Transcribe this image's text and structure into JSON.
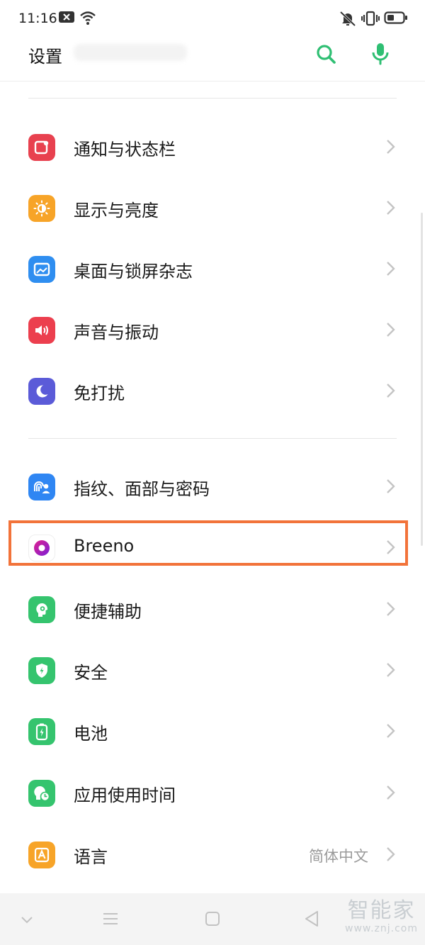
{
  "status_bar": {
    "time": "11:16"
  },
  "header": {
    "title": "设置"
  },
  "sections": [
    {
      "items": [
        {
          "label": "通知与状态栏",
          "icon": "notification-icon",
          "color": "#e8414f"
        },
        {
          "label": "显示与亮度",
          "icon": "brightness-icon",
          "color": "#f7a428"
        },
        {
          "label": "桌面与锁屏杂志",
          "icon": "wallpaper-icon",
          "color": "#2f8ef0"
        },
        {
          "label": "声音与振动",
          "icon": "speaker-icon",
          "color": "#ec3f4e"
        },
        {
          "label": "免打扰",
          "icon": "moon-icon",
          "color": "#5b5bd8"
        }
      ]
    },
    {
      "items": [
        {
          "label": "指纹、面部与密码",
          "icon": "fingerprint-icon",
          "color": "#2f86f3"
        },
        {
          "label": "Breeno",
          "icon": "breeno-icon",
          "color": "#ffffff"
        },
        {
          "label": "便捷辅助",
          "icon": "assist-icon",
          "color": "#35c46e"
        },
        {
          "label": "安全",
          "icon": "shield-icon",
          "color": "#35c46e"
        },
        {
          "label": "电池",
          "icon": "battery-icon",
          "color": "#35c46e"
        },
        {
          "label": "应用使用时间",
          "icon": "usage-time-icon",
          "color": "#35c46e"
        },
        {
          "label": "语言",
          "icon": "language-icon",
          "color": "#f7a428",
          "value": "简体中文"
        }
      ]
    }
  ],
  "accent_color": "#2fbf73",
  "highlight_color": "#f2733a",
  "watermark": {
    "brand": "智能家",
    "url": "www.znj.com"
  }
}
